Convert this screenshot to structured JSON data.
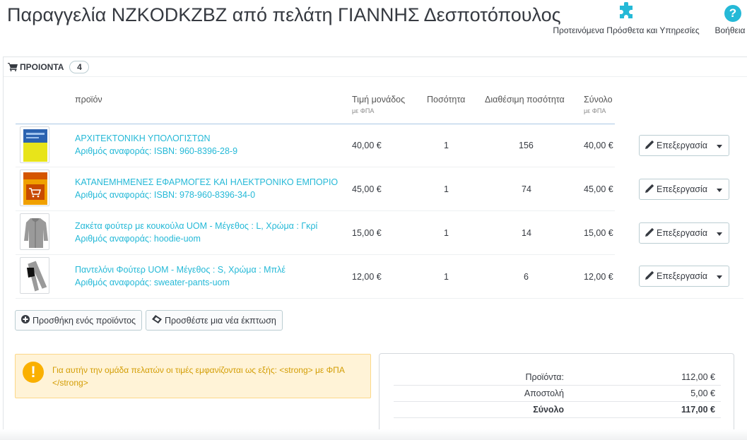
{
  "header": {
    "title": "Παραγγελία NZKODKZBZ από πελάτη ΓΙΑΝΝΗΣ Δεσποτόπουλος",
    "addons_label": "Προτεινόμενα Πρόσθετα και Υπηρεσίες",
    "help_label": "Βοήθεια"
  },
  "colors": {
    "accent": "#25b9d7",
    "warning_bg": "#fff3d7",
    "warning_text": "#d39d04",
    "warning_icon": "#fab000"
  },
  "products_panel": {
    "title": "ΠΡΟΙΟΝΤΑ",
    "count": "4",
    "columns": {
      "product": "προϊόν",
      "unit_price": "Τιμή μονάδος",
      "unit_price_sub": "με ΦΠΑ",
      "quantity": "Ποσότητα",
      "available": "Διαθέσιμη ποσότητα",
      "total": "Σύνολο",
      "total_sub": "με ΦΠΑ"
    },
    "rows": [
      {
        "name": "ΑΡΧΙΤΕΚΤΟΝΙΚΗ ΥΠΟΛΟΓΙΣΤΩΝ",
        "reference": "Αριθμός αναφοράς: ISBN: 960-8396-28-9",
        "unit_price": "40,00 €",
        "quantity": "1",
        "available": "156",
        "total": "40,00 €",
        "edit_label": "Επεξεργασία",
        "thumb": "book-yellow"
      },
      {
        "name": "ΚΑΤΑΝΕΜΗΜΕΝΕΣ ΕΦΑΡΜΟΓΕΣ ΚΑΙ ΗΛΕΚΤΡΟΝΙΚΟ ΕΜΠΟΡΙΟ",
        "reference": "Αριθμός αναφοράς: ISBN: 978-960-8396-34-0",
        "unit_price": "45,00 €",
        "quantity": "1",
        "available": "74",
        "total": "45,00 €",
        "edit_label": "Επεξεργασία",
        "thumb": "book-orange"
      },
      {
        "name": "Ζακέτα φούτερ με κουκούλα UOM - Μέγεθος : L, Χρώμα : Γκρί",
        "reference": "Αριθμός αναφοράς: hoodie-uom",
        "unit_price": "15,00 €",
        "quantity": "1",
        "available": "14",
        "total": "15,00 €",
        "edit_label": "Επεξεργασία",
        "thumb": "hoodie"
      },
      {
        "name": "Παντελόνι Φούτερ UOM - Μέγεθος : S, Χρώμα : Μπλέ",
        "reference": "Αριθμός αναφοράς: sweater-pants-uom",
        "unit_price": "12,00 €",
        "quantity": "1",
        "available": "6",
        "total": "12,00 €",
        "edit_label": "Επεξεργασία",
        "thumb": "pants"
      }
    ],
    "add_product_label": "Προσθήκη ενός προϊόντος",
    "add_discount_label": "Προσθέστε μια νέα έκπτωση"
  },
  "alert": {
    "text": "Για αυτήν την ομάδα πελατών οι τιμές εμφανίζονται ως εξής: <strong> με ΦΠΑ </strong>"
  },
  "totals": {
    "products_label": "Προϊόντα:",
    "products_value": "112,00 €",
    "shipping_label": "Αποστολή",
    "shipping_value": "5,00 €",
    "total_label": "Σύνολο",
    "total_value": "117,00 €"
  }
}
